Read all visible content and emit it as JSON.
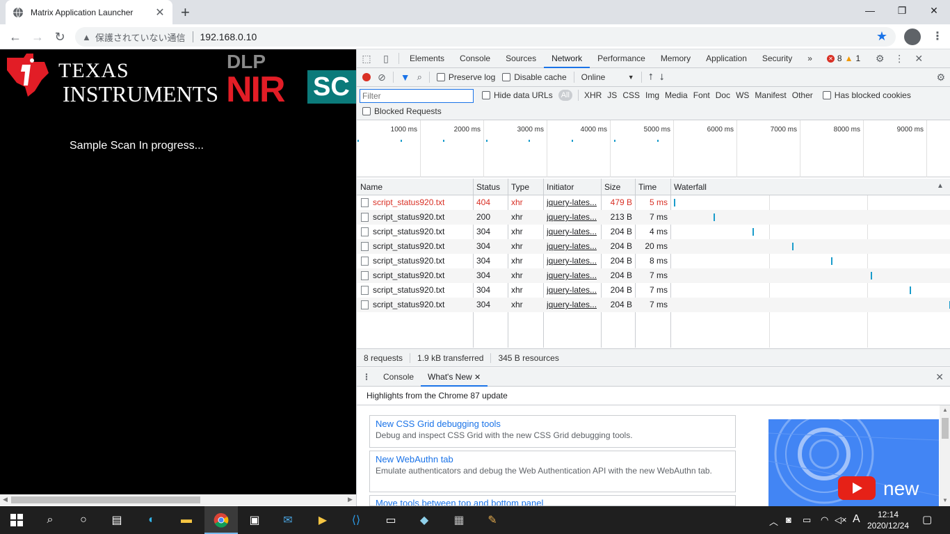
{
  "browser": {
    "tab_title": "Matrix Application Launcher",
    "security_warning": "保護されていない通信",
    "url": "192.168.0.10"
  },
  "page": {
    "logo_texas": "TEXAS",
    "logo_instruments": "INSTRUMENTS",
    "logo_dlp": "DLP",
    "logo_nir": "NIR",
    "logo_sc": "SC",
    "status_text": "Sample Scan In progress..."
  },
  "devtools": {
    "tabs": [
      "Elements",
      "Console",
      "Sources",
      "Network",
      "Performance",
      "Memory",
      "Application",
      "Security"
    ],
    "more_tabs": "»",
    "error_count": "8",
    "warning_count": "1",
    "toolbar": {
      "preserve_log": "Preserve log",
      "disable_cache": "Disable cache",
      "throttle": "Online"
    },
    "filter": {
      "placeholder": "Filter",
      "hide_data_urls": "Hide data URLs",
      "all": "All",
      "types": [
        "XHR",
        "JS",
        "CSS",
        "Img",
        "Media",
        "Font",
        "Doc",
        "WS",
        "Manifest",
        "Other"
      ],
      "has_blocked_cookies": "Has blocked cookies",
      "blocked_requests": "Blocked Requests"
    },
    "overview_ticks": [
      "1000 ms",
      "2000 ms",
      "3000 ms",
      "4000 ms",
      "5000 ms",
      "6000 ms",
      "7000 ms",
      "8000 ms",
      "9000 ms"
    ],
    "columns": [
      "Name",
      "Status",
      "Type",
      "Initiator",
      "Size",
      "Time",
      "Waterfall"
    ],
    "rows": [
      {
        "name": "script_status920.txt",
        "status": "404",
        "type": "xhr",
        "initiator": "jquery-lates...",
        "size": "479 B",
        "time": "5 ms",
        "error": true
      },
      {
        "name": "script_status920.txt",
        "status": "200",
        "type": "xhr",
        "initiator": "jquery-lates...",
        "size": "213 B",
        "time": "7 ms",
        "error": false
      },
      {
        "name": "script_status920.txt",
        "status": "304",
        "type": "xhr",
        "initiator": "jquery-lates...",
        "size": "204 B",
        "time": "4 ms",
        "error": false
      },
      {
        "name": "script_status920.txt",
        "status": "304",
        "type": "xhr",
        "initiator": "jquery-lates...",
        "size": "204 B",
        "time": "20 ms",
        "error": false
      },
      {
        "name": "script_status920.txt",
        "status": "304",
        "type": "xhr",
        "initiator": "jquery-lates...",
        "size": "204 B",
        "time": "8 ms",
        "error": false
      },
      {
        "name": "script_status920.txt",
        "status": "304",
        "type": "xhr",
        "initiator": "jquery-lates...",
        "size": "204 B",
        "time": "7 ms",
        "error": false
      },
      {
        "name": "script_status920.txt",
        "status": "304",
        "type": "xhr",
        "initiator": "jquery-lates...",
        "size": "204 B",
        "time": "7 ms",
        "error": false
      },
      {
        "name": "script_status920.txt",
        "status": "304",
        "type": "xhr",
        "initiator": "jquery-lates...",
        "size": "204 B",
        "time": "7 ms",
        "error": false
      }
    ],
    "summary": {
      "requests": "8 requests",
      "transferred": "1.9 kB transferred",
      "resources": "345 B resources"
    },
    "drawer": {
      "console_tab": "Console",
      "whats_new_tab": "What's New",
      "highlights": "Highlights from the Chrome 87 update",
      "cards": [
        {
          "title": "New CSS Grid debugging tools",
          "desc": "Debug and inspect CSS Grid with the new CSS Grid debugging tools."
        },
        {
          "title": "New WebAuthn tab",
          "desc": "Emulate authenticators and debug the Web Authentication API with the new WebAuthn tab."
        },
        {
          "title": "Move tools between top and bottom panel",
          "desc": ""
        }
      ],
      "promo_text": "new"
    }
  },
  "taskbar": {
    "time": "12:14",
    "date": "2020/12/24",
    "ime": "A"
  }
}
